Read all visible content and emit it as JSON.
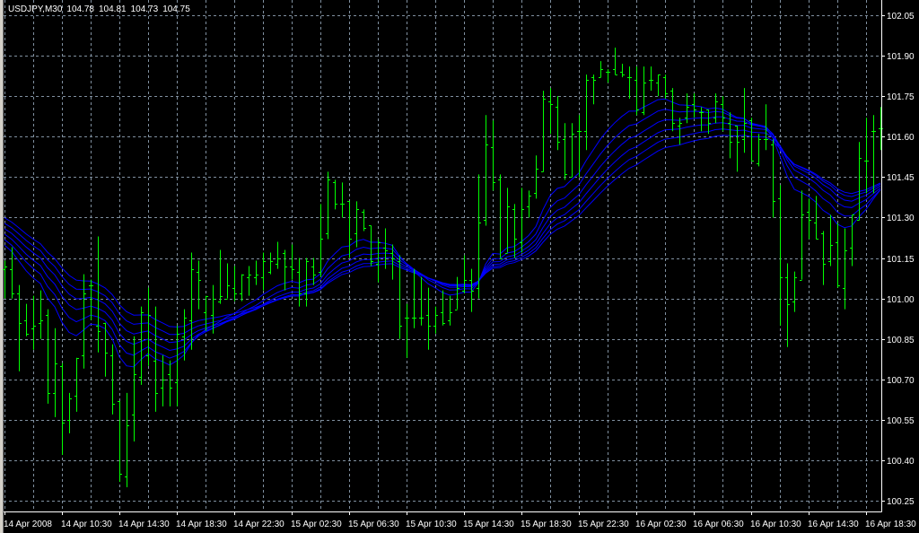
{
  "header": {
    "symbol": "USDJPY,M30",
    "open": "104.78",
    "high": "104.81",
    "low": "104.73",
    "close": "104.75"
  },
  "colors": {
    "background": "#000000",
    "grid": "#8090a0",
    "bars": "#00ff00",
    "moving_averages": "#0000ff",
    "axis": "#ffffff"
  },
  "chart_data": {
    "type": "ohlc",
    "symbol": "USDJPY",
    "timeframe": "M30",
    "ylim": [
      100.2,
      102.1
    ],
    "price_ticks": [
      "102.05",
      "101.90",
      "101.75",
      "101.60",
      "101.45",
      "101.30",
      "101.15",
      "101.00",
      "100.85",
      "100.70",
      "100.55",
      "100.40",
      "100.25"
    ],
    "time_labels": [
      "14 Apr 2008",
      "14 Apr 10:30",
      "14 Apr 14:30",
      "14 Apr 18:30",
      "14 Apr 22:30",
      "15 Apr 02:30",
      "15 Apr 06:30",
      "15 Apr 10:30",
      "15 Apr 14:30",
      "15 Apr 18:30",
      "15 Apr 22:30",
      "16 Apr 02:30",
      "16 Apr 06:30",
      "16 Apr 10:30",
      "16 Apr 14:30",
      "16 Apr 18:30"
    ],
    "bars_per_label": 8,
    "grid": true,
    "ohlc_fields": [
      "open",
      "high",
      "low",
      "close"
    ],
    "bars": [
      [
        101.11,
        101.14,
        101.0,
        101.12
      ],
      [
        101.11,
        101.19,
        101.0,
        101.02
      ],
      [
        101.02,
        101.05,
        100.73,
        100.91
      ],
      [
        100.92,
        100.98,
        100.86,
        100.87
      ],
      [
        100.89,
        101.01,
        100.81,
        100.9
      ],
      [
        100.91,
        101.03,
        100.85,
        100.92
      ],
      [
        100.94,
        100.96,
        100.61,
        100.65
      ],
      [
        100.65,
        100.89,
        100.56,
        100.76
      ],
      [
        100.75,
        100.76,
        100.42,
        100.54
      ],
      [
        100.55,
        100.65,
        100.5,
        100.63
      ],
      [
        100.64,
        100.78,
        100.58,
        100.78
      ],
      [
        100.79,
        101.09,
        100.74,
        101.02
      ],
      [
        101.05,
        101.07,
        100.92,
        101.05
      ],
      [
        100.9,
        101.23,
        100.8,
        100.88
      ],
      [
        100.91,
        100.91,
        100.71,
        100.8
      ],
      [
        100.79,
        100.83,
        100.57,
        100.61
      ],
      [
        100.62,
        100.62,
        100.32,
        100.35
      ],
      [
        100.34,
        100.65,
        100.3,
        100.53
      ],
      [
        100.57,
        100.86,
        100.47,
        100.72
      ],
      [
        100.71,
        100.97,
        100.68,
        100.95
      ],
      [
        100.79,
        101.04,
        100.75,
        100.94
      ],
      [
        100.77,
        100.97,
        100.58,
        100.65
      ],
      [
        100.67,
        100.79,
        100.6,
        100.7
      ],
      [
        100.72,
        100.77,
        100.6,
        100.67
      ],
      [
        100.69,
        100.9,
        100.6,
        100.87
      ],
      [
        100.86,
        100.96,
        100.77,
        100.93
      ],
      [
        100.92,
        101.17,
        100.81,
        101.11
      ],
      [
        101.1,
        101.14,
        100.96,
        101.07
      ],
      [
        100.95,
        101.01,
        100.88,
        101.01
      ],
      [
        100.94,
        101.05,
        100.87,
        101.0
      ],
      [
        100.99,
        101.18,
        100.98,
        101.01
      ],
      [
        101.0,
        101.13,
        101.0,
        101.05
      ],
      [
        101.04,
        101.12,
        100.99,
        101.02
      ],
      [
        101.02,
        101.09,
        100.99,
        101.09
      ],
      [
        101.08,
        101.12,
        101.01,
        101.09
      ],
      [
        101.08,
        101.14,
        101.05,
        101.09
      ],
      [
        101.08,
        101.17,
        101.03,
        101.14
      ],
      [
        101.1,
        101.17,
        101.09,
        101.14
      ],
      [
        101.13,
        101.21,
        101.11,
        101.15
      ],
      [
        101.17,
        101.18,
        101.03,
        101.12
      ],
      [
        101.12,
        101.2,
        101.07,
        101.11
      ],
      [
        101.1,
        101.15,
        100.97,
        101.02
      ],
      [
        101.02,
        101.15,
        100.97,
        101.14
      ],
      [
        101.12,
        101.15,
        101.05,
        101.09
      ],
      [
        101.1,
        101.35,
        101.08,
        101.22
      ],
      [
        101.24,
        101.47,
        101.22,
        101.44
      ],
      [
        101.43,
        101.44,
        101.33,
        101.35
      ],
      [
        101.35,
        101.43,
        101.3,
        101.35
      ],
      [
        101.36,
        101.36,
        101.15,
        101.22
      ],
      [
        101.24,
        101.36,
        101.19,
        101.33
      ],
      [
        101.32,
        101.33,
        101.25,
        101.26
      ],
      [
        101.27,
        101.27,
        101.12,
        101.14
      ],
      [
        101.13,
        101.22,
        101.06,
        101.21
      ],
      [
        101.19,
        101.26,
        101.11,
        101.18
      ],
      [
        101.17,
        101.2,
        101.07,
        101.15
      ],
      [
        101.14,
        101.16,
        100.85,
        100.9
      ],
      [
        100.93,
        100.98,
        100.78,
        100.93
      ],
      [
        100.93,
        101.11,
        100.89,
        100.93
      ],
      [
        100.93,
        101.08,
        100.9,
        100.93
      ],
      [
        100.94,
        101.04,
        100.81,
        100.9
      ],
      [
        100.9,
        100.97,
        100.87,
        100.94
      ],
      [
        100.95,
        101.03,
        100.9,
        100.91
      ],
      [
        100.92,
        101.01,
        100.9,
        100.95
      ],
      [
        100.96,
        101.08,
        100.96,
        101.04
      ],
      [
        101.03,
        101.16,
        101.02,
        101.07
      ],
      [
        101.07,
        101.11,
        100.95,
        101.03
      ],
      [
        101.04,
        101.46,
        101.0,
        101.28
      ],
      [
        101.29,
        101.68,
        101.27,
        101.57
      ],
      [
        101.56,
        101.66,
        101.4,
        101.43
      ],
      [
        101.44,
        101.46,
        101.15,
        101.15
      ],
      [
        101.17,
        101.41,
        101.17,
        101.34
      ],
      [
        101.33,
        101.35,
        101.15,
        101.22
      ],
      [
        101.21,
        101.41,
        101.17,
        101.33
      ],
      [
        101.34,
        101.4,
        101.3,
        101.38
      ],
      [
        101.39,
        101.53,
        101.37,
        101.48
      ],
      [
        101.47,
        101.77,
        101.47,
        101.74
      ],
      [
        101.73,
        101.78,
        101.61,
        101.72
      ],
      [
        101.71,
        101.75,
        101.55,
        101.58
      ],
      [
        101.59,
        101.65,
        101.44,
        101.46
      ],
      [
        101.45,
        101.65,
        101.45,
        101.61
      ],
      [
        101.62,
        101.68,
        101.45,
        101.62
      ],
      [
        101.62,
        101.83,
        101.55,
        101.81
      ],
      [
        101.82,
        101.83,
        101.72,
        101.81
      ],
      [
        101.82,
        101.88,
        101.82,
        101.85
      ],
      [
        101.84,
        101.85,
        101.8,
        101.84
      ],
      [
        101.85,
        101.93,
        101.83,
        101.83
      ],
      [
        101.84,
        101.87,
        101.82,
        101.83
      ],
      [
        101.82,
        101.86,
        101.74,
        101.82
      ],
      [
        101.81,
        101.86,
        101.68,
        101.7
      ],
      [
        101.69,
        101.86,
        101.68,
        101.8
      ],
      [
        101.81,
        101.86,
        101.77,
        101.81
      ],
      [
        101.8,
        101.83,
        101.75,
        101.83
      ],
      [
        101.82,
        101.83,
        101.74,
        101.76
      ],
      [
        101.77,
        101.78,
        101.62,
        101.65
      ],
      [
        101.64,
        101.67,
        101.57,
        101.65
      ],
      [
        101.67,
        101.76,
        101.65,
        101.71
      ],
      [
        101.72,
        101.76,
        101.67,
        101.7
      ],
      [
        101.69,
        101.71,
        101.62,
        101.69
      ],
      [
        101.7,
        101.7,
        101.61,
        101.65
      ],
      [
        101.67,
        101.76,
        101.65,
        101.73
      ],
      [
        101.72,
        101.75,
        101.62,
        101.67
      ],
      [
        101.65,
        101.69,
        101.52,
        101.58
      ],
      [
        101.64,
        101.64,
        101.47,
        101.58
      ],
      [
        101.59,
        101.78,
        101.54,
        101.65
      ],
      [
        101.66,
        101.67,
        101.51,
        101.51
      ],
      [
        101.5,
        101.61,
        101.49,
        101.59
      ],
      [
        101.59,
        101.72,
        101.55,
        101.59
      ],
      [
        101.57,
        101.59,
        101.3,
        101.36
      ],
      [
        101.37,
        101.42,
        100.9,
        101.08
      ],
      [
        101.08,
        101.13,
        100.82,
        100.98
      ],
      [
        100.99,
        101.1,
        100.95,
        101.08
      ],
      [
        101.07,
        101.4,
        101.07,
        101.31
      ],
      [
        101.32,
        101.37,
        101.22,
        101.29
      ],
      [
        101.28,
        101.38,
        101.22,
        101.22
      ],
      [
        101.24,
        101.25,
        101.05,
        101.13
      ],
      [
        101.14,
        101.31,
        101.12,
        101.2
      ],
      [
        101.21,
        101.28,
        101.04,
        101.05
      ],
      [
        101.04,
        101.26,
        100.96,
        101.18
      ],
      [
        101.19,
        101.31,
        101.12,
        101.31
      ],
      [
        101.29,
        101.58,
        101.29,
        101.52
      ],
      [
        101.51,
        101.67,
        101.39,
        101.51
      ],
      [
        101.62,
        101.68,
        101.39,
        101.62
      ],
      [
        101.63,
        101.71,
        101.55,
        101.63
      ]
    ],
    "indicators": {
      "type": "ema-ribbon",
      "periods": [
        14,
        18,
        22,
        26,
        30,
        34
      ],
      "seeds": [
        101.21,
        101.23,
        101.25,
        101.27,
        101.29,
        101.31
      ]
    }
  }
}
